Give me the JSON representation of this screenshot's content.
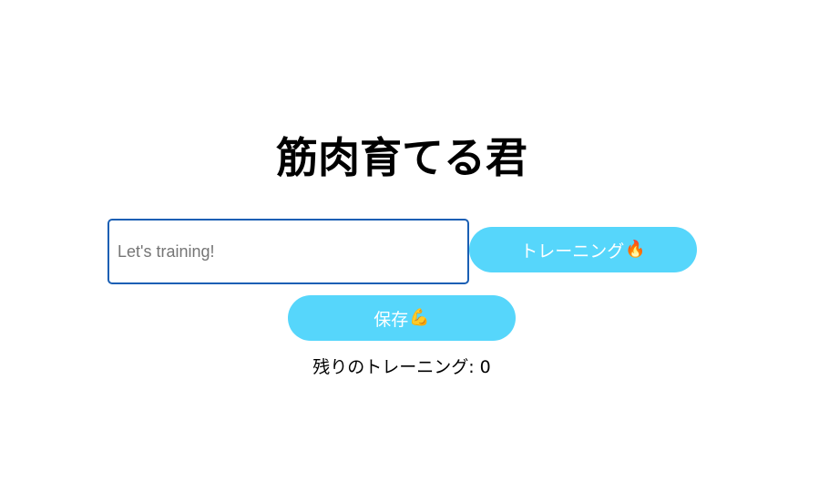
{
  "app": {
    "title": "筋肉育てる君"
  },
  "form": {
    "input_placeholder": "Let's training!",
    "input_value": "",
    "training_button_label": "トレーニング",
    "training_button_icon": "fire-icon",
    "training_button_emoji": "🔥",
    "save_button_label": "保存",
    "save_button_icon": "flexed-biceps-icon",
    "save_button_emoji": "💪"
  },
  "status": {
    "remaining_label": "残りのトレーニング: ",
    "remaining_count": "0"
  },
  "colors": {
    "button_bg": "#56d6fb",
    "input_border": "#1a5fb4",
    "text": "#000000"
  }
}
